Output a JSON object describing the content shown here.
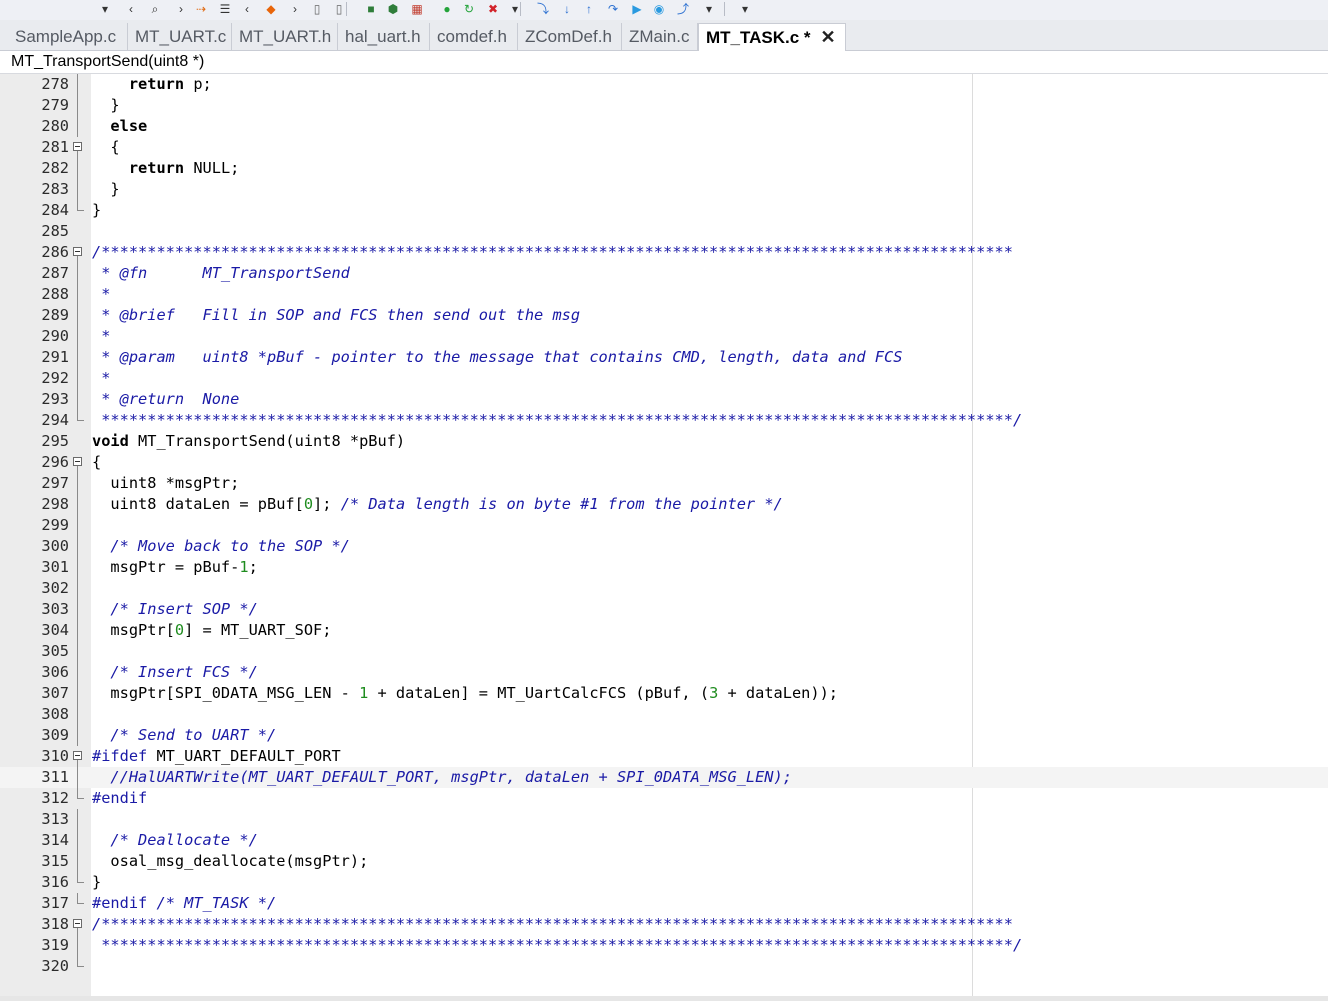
{
  "toolbar": {
    "items": [
      {
        "name": "dropdown-arrow-icon",
        "glyph": "▾"
      },
      {
        "name": "back-icon",
        "glyph": "‹"
      },
      {
        "name": "find-icon",
        "glyph": "⌕"
      },
      {
        "name": "forward-icon",
        "glyph": "›"
      },
      {
        "name": "goto-arrow-icon",
        "glyph": "⇢"
      },
      {
        "name": "list-icon",
        "glyph": "☰"
      },
      {
        "name": "nav-back-icon",
        "glyph": "‹"
      },
      {
        "name": "bookmark-icon",
        "glyph": "◆"
      },
      {
        "name": "nav-forward-icon",
        "glyph": "›"
      },
      {
        "name": "file-icon",
        "glyph": "▯"
      },
      {
        "name": "file2-icon",
        "glyph": "▯"
      },
      {
        "name": "make-icon",
        "glyph": "■"
      },
      {
        "name": "build-icon",
        "glyph": "⬢"
      },
      {
        "name": "grid-icon",
        "glyph": "▦"
      },
      {
        "name": "run-icon",
        "glyph": "●"
      },
      {
        "name": "rebuild-icon",
        "glyph": "↻"
      },
      {
        "name": "stop-icon",
        "glyph": "✖"
      },
      {
        "name": "overflow-icon",
        "glyph": "▾"
      },
      {
        "name": "step-over-icon",
        "glyph": "⤵"
      },
      {
        "name": "step-into-icon",
        "glyph": "↓"
      },
      {
        "name": "step-out-icon",
        "glyph": "↑"
      },
      {
        "name": "debug-icon",
        "glyph": "↷"
      },
      {
        "name": "go-icon",
        "glyph": "▶"
      },
      {
        "name": "break-icon",
        "glyph": "◉"
      },
      {
        "name": "reset-icon",
        "glyph": "⤴"
      },
      {
        "name": "more-icon",
        "glyph": "▾"
      },
      {
        "name": "overflow2-icon",
        "glyph": "▾"
      }
    ]
  },
  "tabs": [
    {
      "label": "SampleApp.c"
    },
    {
      "label": "MT_UART.c"
    },
    {
      "label": "MT_UART.h"
    },
    {
      "label": "hal_uart.h"
    },
    {
      "label": "comdef.h"
    },
    {
      "label": "ZComDef.h"
    },
    {
      "label": "ZMain.c"
    },
    {
      "label": "MT_TASK.c *",
      "active": true,
      "close_glyph": "✕"
    }
  ],
  "function_bar": {
    "label": "MT_TransportSend(uint8 *)"
  },
  "colors": {
    "comment": "#1a1aa6",
    "number": "#1e8c1e",
    "gutter": "#ececec"
  },
  "editor": {
    "lines": [
      {
        "num": "278",
        "fold": "line",
        "segments": [
          {
            "t": "    "
          },
          {
            "t": "return",
            "k": "kw"
          },
          {
            "t": " p;"
          }
        ]
      },
      {
        "num": "279",
        "fold": "line",
        "segments": [
          {
            "t": "  }"
          }
        ]
      },
      {
        "num": "280",
        "fold": "line",
        "segments": [
          {
            "t": "  "
          },
          {
            "t": "else",
            "k": "kw"
          }
        ]
      },
      {
        "num": "281",
        "fold": "box",
        "segments": [
          {
            "t": "  {"
          }
        ]
      },
      {
        "num": "282",
        "fold": "line",
        "segments": [
          {
            "t": "    "
          },
          {
            "t": "return",
            "k": "kw"
          },
          {
            "t": " NULL;"
          }
        ]
      },
      {
        "num": "283",
        "fold": "line",
        "segments": [
          {
            "t": "  }"
          }
        ]
      },
      {
        "num": "284",
        "fold": "end",
        "segments": [
          {
            "t": "}"
          }
        ]
      },
      {
        "num": "285",
        "fold": "",
        "segments": [
          {
            "t": ""
          }
        ]
      },
      {
        "num": "286",
        "fold": "box",
        "segments": [
          {
            "t": "/***************************************************************************************************",
            "k": "cm"
          }
        ]
      },
      {
        "num": "287",
        "fold": "line",
        "segments": [
          {
            "t": " * @fn      MT_TransportSend",
            "k": "cm"
          }
        ]
      },
      {
        "num": "288",
        "fold": "line",
        "segments": [
          {
            "t": " *",
            "k": "cm"
          }
        ]
      },
      {
        "num": "289",
        "fold": "line",
        "segments": [
          {
            "t": " * @brief   Fill in SOP and FCS then send out the msg",
            "k": "cm"
          }
        ]
      },
      {
        "num": "290",
        "fold": "line",
        "segments": [
          {
            "t": " *",
            "k": "cm"
          }
        ]
      },
      {
        "num": "291",
        "fold": "line",
        "segments": [
          {
            "t": " * @param   uint8 *pBuf - pointer to the message that contains CMD, length, data and FCS",
            "k": "cm"
          }
        ]
      },
      {
        "num": "292",
        "fold": "line",
        "segments": [
          {
            "t": " *",
            "k": "cm"
          }
        ]
      },
      {
        "num": "293",
        "fold": "line",
        "segments": [
          {
            "t": " * @return  None",
            "k": "cm"
          }
        ]
      },
      {
        "num": "294",
        "fold": "end",
        "segments": [
          {
            "t": " ***************************************************************************************************/",
            "k": "cm"
          }
        ]
      },
      {
        "num": "295",
        "fold": "",
        "segments": [
          {
            "t": "void",
            "k": "kw"
          },
          {
            "t": " MT_TransportSend(uint8 *pBuf)"
          }
        ]
      },
      {
        "num": "296",
        "fold": "box",
        "segments": [
          {
            "t": "{"
          }
        ]
      },
      {
        "num": "297",
        "fold": "line",
        "segments": [
          {
            "t": "  uint8 *msgPtr;"
          }
        ]
      },
      {
        "num": "298",
        "fold": "line",
        "segments": [
          {
            "t": "  uint8 dataLen = pBuf["
          },
          {
            "t": "0",
            "k": "num"
          },
          {
            "t": "]; "
          },
          {
            "t": "/* Data length is on byte #1 from the pointer */",
            "k": "cm"
          }
        ]
      },
      {
        "num": "299",
        "fold": "line",
        "segments": [
          {
            "t": ""
          }
        ]
      },
      {
        "num": "300",
        "fold": "line",
        "segments": [
          {
            "t": "  "
          },
          {
            "t": "/* Move back to the SOP */",
            "k": "cm"
          }
        ]
      },
      {
        "num": "301",
        "fold": "line",
        "segments": [
          {
            "t": "  msgPtr = pBuf-"
          },
          {
            "t": "1",
            "k": "num"
          },
          {
            "t": ";"
          }
        ]
      },
      {
        "num": "302",
        "fold": "line",
        "segments": [
          {
            "t": ""
          }
        ]
      },
      {
        "num": "303",
        "fold": "line",
        "segments": [
          {
            "t": "  "
          },
          {
            "t": "/* Insert SOP */",
            "k": "cm"
          }
        ]
      },
      {
        "num": "304",
        "fold": "line",
        "segments": [
          {
            "t": "  msgPtr["
          },
          {
            "t": "0",
            "k": "num"
          },
          {
            "t": "] = MT_UART_SOF;"
          }
        ]
      },
      {
        "num": "305",
        "fold": "line",
        "segments": [
          {
            "t": ""
          }
        ]
      },
      {
        "num": "306",
        "fold": "line",
        "segments": [
          {
            "t": "  "
          },
          {
            "t": "/* Insert FCS */",
            "k": "cm"
          }
        ]
      },
      {
        "num": "307",
        "fold": "line",
        "segments": [
          {
            "t": "  msgPtr[SPI_0DATA_MSG_LEN - "
          },
          {
            "t": "1",
            "k": "num"
          },
          {
            "t": " + dataLen] = MT_UartCalcFCS (pBuf, ("
          },
          {
            "t": "3",
            "k": "num"
          },
          {
            "t": " + dataLen));"
          }
        ]
      },
      {
        "num": "308",
        "fold": "line",
        "segments": [
          {
            "t": ""
          }
        ]
      },
      {
        "num": "309",
        "fold": "line",
        "segments": [
          {
            "t": "  "
          },
          {
            "t": "/* Send to UART */",
            "k": "cm"
          }
        ]
      },
      {
        "num": "310",
        "fold": "box",
        "segments": [
          {
            "t": "#ifdef",
            "k": "pp"
          },
          {
            "t": " MT_UART_DEFAULT_PORT"
          }
        ]
      },
      {
        "num": "311",
        "fold": "line",
        "current": true,
        "segments": [
          {
            "t": "  "
          },
          {
            "t": "//HalUARTWrite(MT_UART_DEFAULT_PORT, msgPtr, dataLen + SPI_0DATA_MSG_LEN);",
            "k": "cm"
          }
        ]
      },
      {
        "num": "312",
        "fold": "end",
        "segments": [
          {
            "t": "#endif",
            "k": "pp"
          }
        ]
      },
      {
        "num": "313",
        "fold": "line",
        "segments": [
          {
            "t": ""
          }
        ]
      },
      {
        "num": "314",
        "fold": "line",
        "segments": [
          {
            "t": "  "
          },
          {
            "t": "/* Deallocate */",
            "k": "cm"
          }
        ]
      },
      {
        "num": "315",
        "fold": "line",
        "segments": [
          {
            "t": "  osal_msg_deallocate(msgPtr);"
          }
        ]
      },
      {
        "num": "316",
        "fold": "end",
        "segments": [
          {
            "t": "}"
          }
        ]
      },
      {
        "num": "317",
        "fold": "end",
        "segments": [
          {
            "t": "#endif",
            "k": "pp"
          },
          {
            "t": " "
          },
          {
            "t": "/* MT_TASK */",
            "k": "cm"
          }
        ]
      },
      {
        "num": "318",
        "fold": "box",
        "segments": [
          {
            "t": "/***************************************************************************************************",
            "k": "cm"
          }
        ]
      },
      {
        "num": "319",
        "fold": "line",
        "segments": [
          {
            "t": " ***************************************************************************************************/",
            "k": "cm"
          }
        ]
      },
      {
        "num": "320",
        "fold": "end",
        "segments": [
          {
            "t": ""
          }
        ]
      }
    ]
  }
}
